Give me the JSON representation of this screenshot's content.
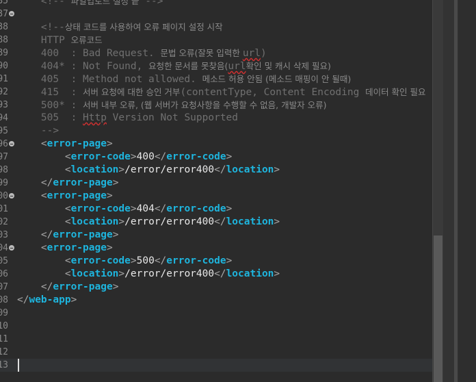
{
  "editor": {
    "lines": [
      {
        "num": "35",
        "fold": false,
        "segs": [
          {
            "c": "cm",
            "t": "    <!-- "
          },
          {
            "c": "kc",
            "t": "파일업로드 설정 끝"
          },
          {
            "c": "cm",
            "t": " -->"
          }
        ]
      },
      {
        "num": "37",
        "fold": true,
        "segs": []
      },
      {
        "num": "38",
        "fold": false,
        "segs": [
          {
            "c": "cm",
            "t": "    <!--"
          },
          {
            "c": "kc",
            "t": "상태 코드를 사용하여 오류 페이지 설정 시작"
          }
        ]
      },
      {
        "num": "88",
        "fold": false,
        "segs": [
          {
            "c": "cm",
            "t": "    HTTP "
          },
          {
            "c": "kc",
            "t": "오류코드"
          }
        ]
      },
      {
        "num": "89",
        "fold": false,
        "segs": [
          {
            "c": "cm",
            "t": "    400  : Bad Request. "
          },
          {
            "c": "kc",
            "t": "문법 오류(잘못 입력한 "
          },
          {
            "c": "cm sq",
            "t": "url"
          },
          {
            "c": "cm",
            "t": ")"
          }
        ]
      },
      {
        "num": "90",
        "fold": false,
        "segs": [
          {
            "c": "cm",
            "t": "    404* : Not Found, "
          },
          {
            "c": "kc",
            "t": "요청한 문서를 못찾음("
          },
          {
            "c": "cm sq",
            "t": "url"
          },
          {
            "c": "kc",
            "t": "확인 및 캐시 삭제 필요)"
          }
        ]
      },
      {
        "num": "91",
        "fold": false,
        "segs": [
          {
            "c": "cm",
            "t": "    405  : Method not allowed. "
          },
          {
            "c": "kc",
            "t": "메소드 허용 안됨 (메소드 매핑이 안 될때)"
          }
        ]
      },
      {
        "num": "92",
        "fold": false,
        "segs": [
          {
            "c": "cm",
            "t": "    415  : "
          },
          {
            "c": "kc",
            "t": "서버 요청에 대한 승인 거부"
          },
          {
            "c": "cm",
            "t": "(contentType, Content Encoding "
          },
          {
            "c": "kc",
            "t": "데이터 확인 필요"
          }
        ]
      },
      {
        "num": "93",
        "fold": false,
        "segs": [
          {
            "c": "cm",
            "t": "    500* : "
          },
          {
            "c": "kc",
            "t": "서버 내부 오류, (웹 서버가 요청사항을 수행할 수 없음, 개발자 오류)"
          }
        ]
      },
      {
        "num": "94",
        "fold": false,
        "segs": [
          {
            "c": "cm",
            "t": "    505  : "
          },
          {
            "c": "cm sq",
            "t": "Http"
          },
          {
            "c": "cm",
            "t": " Version Not Supported"
          }
        ]
      },
      {
        "num": "95",
        "fold": false,
        "segs": [
          {
            "c": "cm",
            "t": "    -->"
          }
        ]
      },
      {
        "num": "96",
        "fold": true,
        "segs": [
          {
            "c": "tx",
            "t": "    "
          },
          {
            "c": "br",
            "t": "<"
          },
          {
            "c": "tag",
            "t": "error-page"
          },
          {
            "c": "br",
            "t": ">"
          }
        ]
      },
      {
        "num": "97",
        "fold": false,
        "segs": [
          {
            "c": "tx",
            "t": "        "
          },
          {
            "c": "br",
            "t": "<"
          },
          {
            "c": "tag",
            "t": "error-code"
          },
          {
            "c": "br",
            "t": ">"
          },
          {
            "c": "tx",
            "t": "400"
          },
          {
            "c": "br",
            "t": "</"
          },
          {
            "c": "tag",
            "t": "error-code"
          },
          {
            "c": "br",
            "t": ">"
          }
        ]
      },
      {
        "num": "98",
        "fold": false,
        "segs": [
          {
            "c": "tx",
            "t": "        "
          },
          {
            "c": "br",
            "t": "<"
          },
          {
            "c": "tag",
            "t": "location"
          },
          {
            "c": "br",
            "t": ">"
          },
          {
            "c": "tx",
            "t": "/error/error400"
          },
          {
            "c": "br",
            "t": "</"
          },
          {
            "c": "tag",
            "t": "location"
          },
          {
            "c": "br",
            "t": ">"
          }
        ]
      },
      {
        "num": "99",
        "fold": false,
        "segs": [
          {
            "c": "tx",
            "t": "    "
          },
          {
            "c": "br",
            "t": "</"
          },
          {
            "c": "tag",
            "t": "error-page"
          },
          {
            "c": "br",
            "t": ">"
          }
        ]
      },
      {
        "num": "00",
        "fold": true,
        "segs": [
          {
            "c": "tx",
            "t": "    "
          },
          {
            "c": "br",
            "t": "<"
          },
          {
            "c": "tag",
            "t": "error-page"
          },
          {
            "c": "br",
            "t": ">"
          }
        ]
      },
      {
        "num": "01",
        "fold": false,
        "segs": [
          {
            "c": "tx",
            "t": "        "
          },
          {
            "c": "br",
            "t": "<"
          },
          {
            "c": "tag",
            "t": "error-code"
          },
          {
            "c": "br",
            "t": ">"
          },
          {
            "c": "tx",
            "t": "404"
          },
          {
            "c": "br",
            "t": "</"
          },
          {
            "c": "tag",
            "t": "error-code"
          },
          {
            "c": "br",
            "t": ">"
          }
        ]
      },
      {
        "num": "02",
        "fold": false,
        "segs": [
          {
            "c": "tx",
            "t": "        "
          },
          {
            "c": "br",
            "t": "<"
          },
          {
            "c": "tag",
            "t": "location"
          },
          {
            "c": "br",
            "t": ">"
          },
          {
            "c": "tx",
            "t": "/error/error400"
          },
          {
            "c": "br",
            "t": "</"
          },
          {
            "c": "tag",
            "t": "location"
          },
          {
            "c": "br",
            "t": ">"
          }
        ]
      },
      {
        "num": "03",
        "fold": false,
        "segs": [
          {
            "c": "tx",
            "t": "    "
          },
          {
            "c": "br",
            "t": "</"
          },
          {
            "c": "tag",
            "t": "error-page"
          },
          {
            "c": "br",
            "t": ">"
          }
        ]
      },
      {
        "num": "04",
        "fold": true,
        "segs": [
          {
            "c": "tx",
            "t": "    "
          },
          {
            "c": "br",
            "t": "<"
          },
          {
            "c": "tag",
            "t": "error-page"
          },
          {
            "c": "br",
            "t": ">"
          }
        ]
      },
      {
        "num": "05",
        "fold": false,
        "segs": [
          {
            "c": "tx",
            "t": "        "
          },
          {
            "c": "br",
            "t": "<"
          },
          {
            "c": "tag",
            "t": "error-code"
          },
          {
            "c": "br",
            "t": ">"
          },
          {
            "c": "tx",
            "t": "500"
          },
          {
            "c": "br",
            "t": "</"
          },
          {
            "c": "tag",
            "t": "error-code"
          },
          {
            "c": "br",
            "t": ">"
          }
        ]
      },
      {
        "num": "06",
        "fold": false,
        "segs": [
          {
            "c": "tx",
            "t": "        "
          },
          {
            "c": "br",
            "t": "<"
          },
          {
            "c": "tag",
            "t": "location"
          },
          {
            "c": "br",
            "t": ">"
          },
          {
            "c": "tx",
            "t": "/error/error400"
          },
          {
            "c": "br",
            "t": "</"
          },
          {
            "c": "tag",
            "t": "location"
          },
          {
            "c": "br",
            "t": ">"
          }
        ]
      },
      {
        "num": "07",
        "fold": false,
        "segs": [
          {
            "c": "tx",
            "t": "    "
          },
          {
            "c": "br",
            "t": "</"
          },
          {
            "c": "tag",
            "t": "error-page"
          },
          {
            "c": "br",
            "t": ">"
          }
        ]
      },
      {
        "num": "08",
        "fold": false,
        "segs": [
          {
            "c": "br",
            "t": "</"
          },
          {
            "c": "tag",
            "t": "web-app"
          },
          {
            "c": "br",
            "t": ">"
          }
        ]
      },
      {
        "num": "09",
        "fold": false,
        "segs": []
      },
      {
        "num": "10",
        "fold": false,
        "segs": []
      },
      {
        "num": "11",
        "fold": false,
        "segs": []
      },
      {
        "num": "12",
        "fold": false,
        "segs": []
      },
      {
        "num": "13",
        "fold": false,
        "segs": [],
        "current": true
      }
    ]
  },
  "colors": {
    "background": "#2b2b2b",
    "comment": "#707070",
    "tag": "#1eb5de",
    "text": "#e8e8e8"
  }
}
